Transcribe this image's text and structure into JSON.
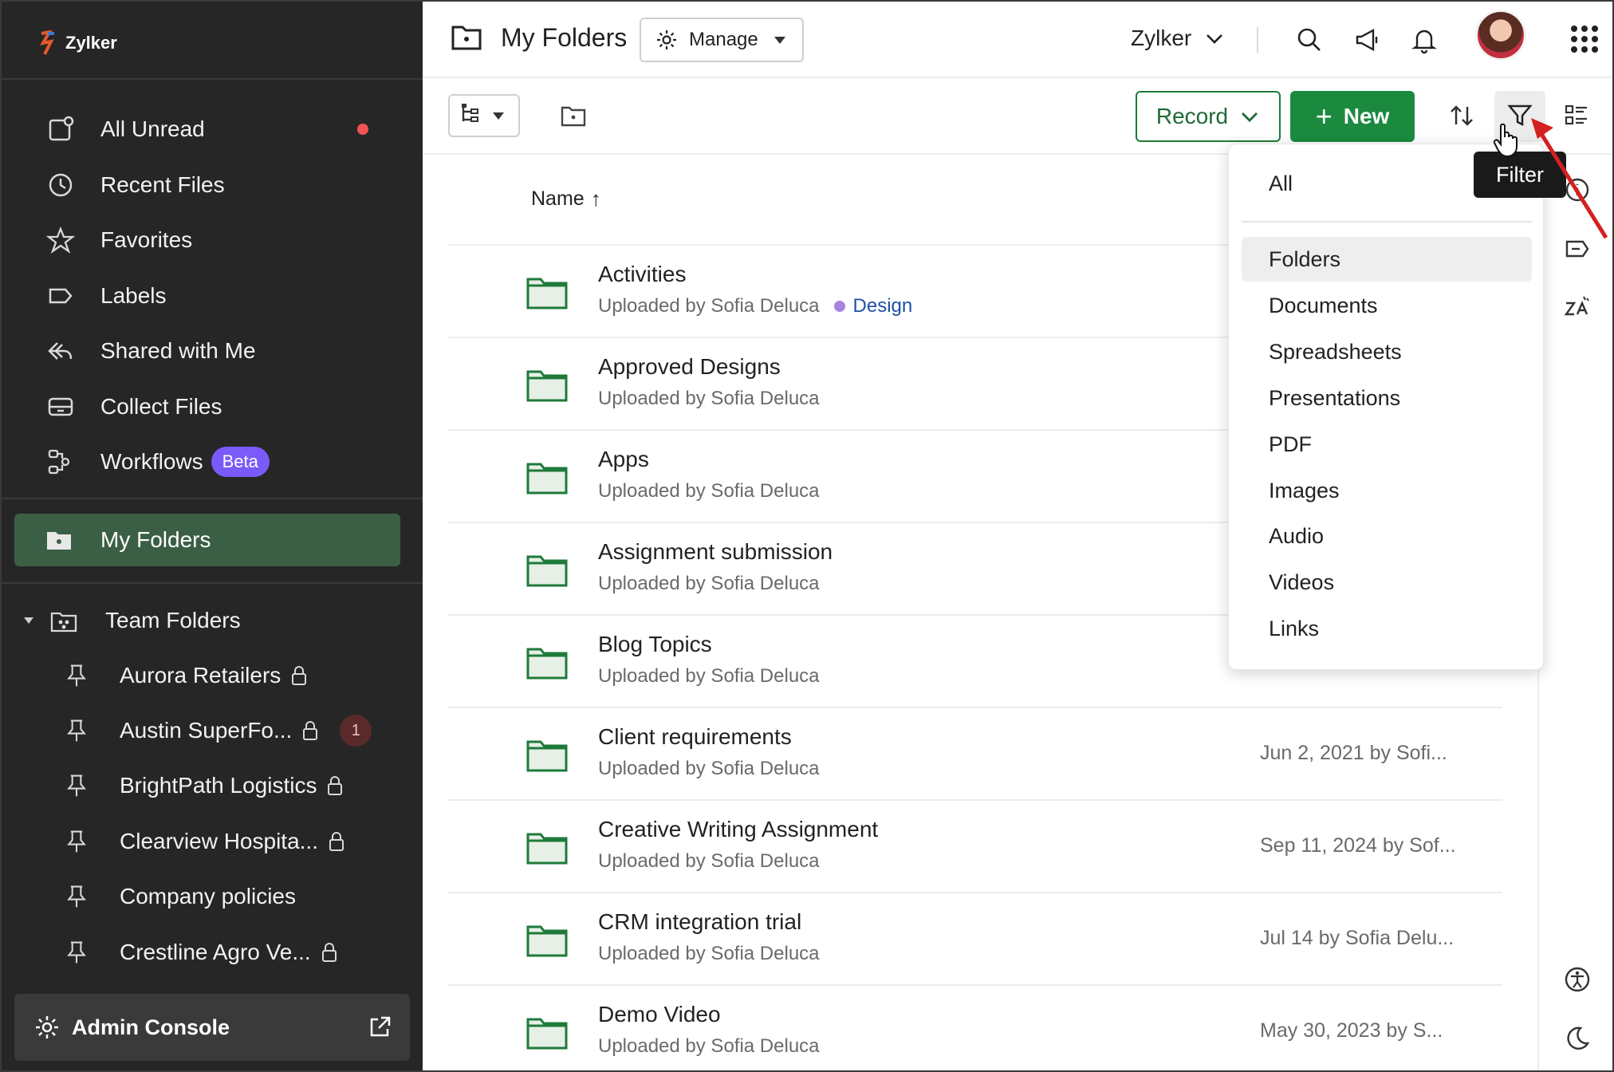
{
  "brand": {
    "name": "Zylker"
  },
  "sidebar": {
    "items": [
      {
        "label": "All Unread",
        "icon": "unread-icon"
      },
      {
        "label": "Recent Files",
        "icon": "clock-icon"
      },
      {
        "label": "Favorites",
        "icon": "star-icon"
      },
      {
        "label": "Labels",
        "icon": "label-icon"
      },
      {
        "label": "Shared with Me",
        "icon": "shared-icon"
      },
      {
        "label": "Collect Files",
        "icon": "tray-icon"
      },
      {
        "label": "Workflows",
        "icon": "workflow-icon",
        "badge": "Beta"
      }
    ],
    "my_folders": "My Folders",
    "team_folders": {
      "label": "Team Folders",
      "items": [
        {
          "label": "Aurora Retailers"
        },
        {
          "label": "Austin SuperFo...",
          "count": "1"
        },
        {
          "label": "BrightPath Logistics"
        },
        {
          "label": "Clearview Hospita..."
        },
        {
          "label": "Company policies"
        },
        {
          "label": "Crestline Agro Ve..."
        }
      ]
    },
    "admin": "Admin Console"
  },
  "header": {
    "title": "My Folders",
    "manage": "Manage",
    "org": "Zylker"
  },
  "toolbar": {
    "record": "Record",
    "new": "New",
    "filter_tooltip": "Filter"
  },
  "list": {
    "column_name": "Name",
    "sort_arrow": "↑",
    "rows": [
      {
        "name": "Activities",
        "sub": "Uploaded by Sofia Deluca",
        "label": "Design",
        "date": ""
      },
      {
        "name": "Approved Designs",
        "sub": "Uploaded by Sofia Deluca",
        "date": ""
      },
      {
        "name": "Apps",
        "sub": "Uploaded by Sofia Deluca",
        "date": ""
      },
      {
        "name": "Assignment submission",
        "sub": "Uploaded by Sofia Deluca",
        "date": ""
      },
      {
        "name": "Blog Topics",
        "sub": "Uploaded by Sofia Deluca",
        "date": ""
      },
      {
        "name": "Client requirements",
        "sub": "Uploaded by Sofia Deluca",
        "date": "Jun 2, 2021 by Sofi..."
      },
      {
        "name": "Creative Writing Assignment",
        "sub": "Uploaded by Sofia Deluca",
        "date": "Sep 11, 2024 by Sof..."
      },
      {
        "name": "CRM integration trial",
        "sub": "Uploaded by Sofia Deluca",
        "date": "Jul 14 by Sofia Delu..."
      },
      {
        "name": "Demo Video",
        "sub": "Uploaded by Sofia Deluca",
        "date": "May 30, 2023 by S..."
      }
    ]
  },
  "filter_menu": {
    "all": "All",
    "items": [
      "Folders",
      "Documents",
      "Spreadsheets",
      "Presentations",
      "PDF",
      "Images",
      "Audio",
      "Videos",
      "Links"
    ],
    "selected": "Folders"
  },
  "colors": {
    "sidebar_bg": "#262626",
    "active_nav": "#3b5f45",
    "primary_green": "#1b8a3f",
    "beta": "#7a5af8",
    "unread_dot": "#f05454"
  }
}
